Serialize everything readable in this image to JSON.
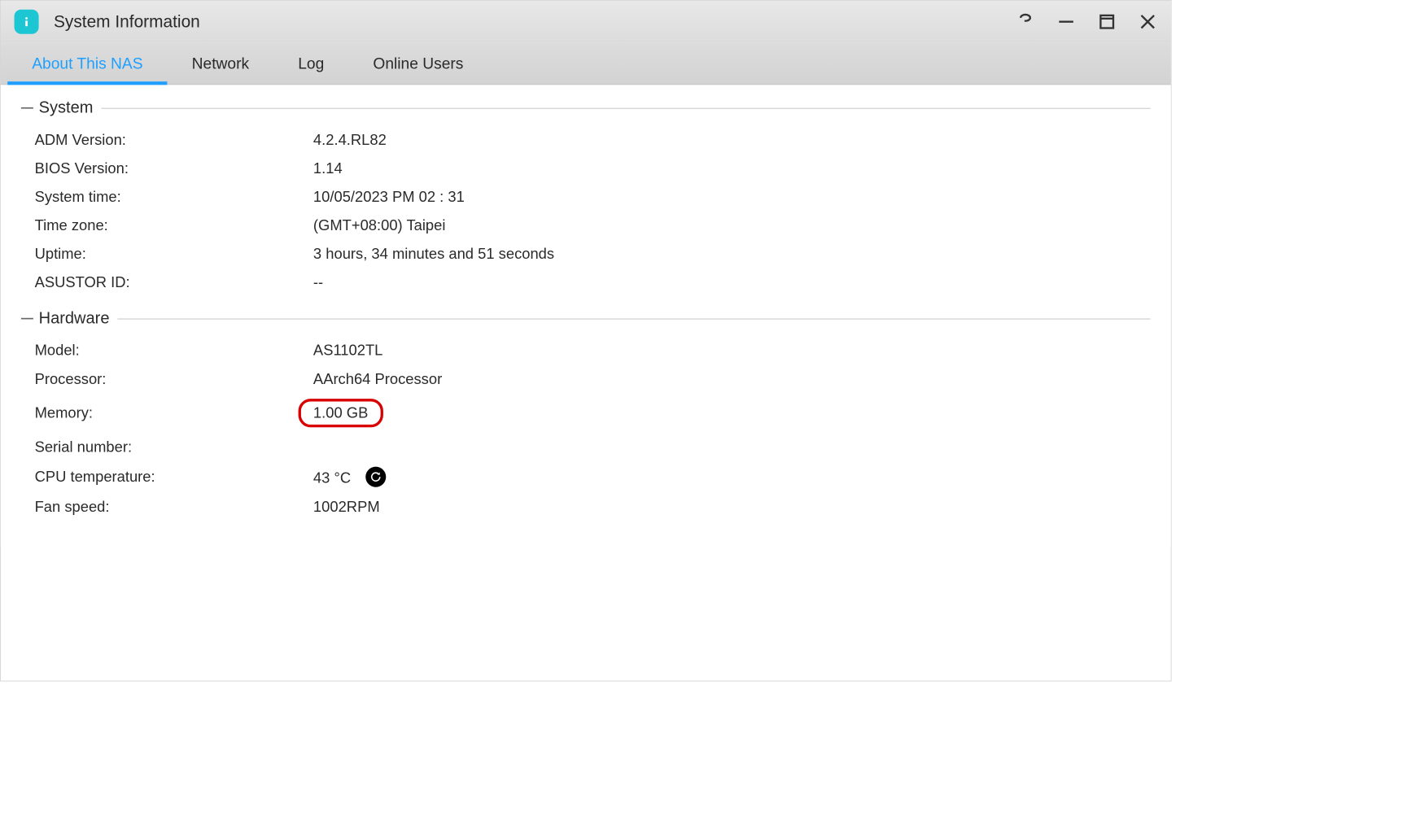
{
  "window": {
    "title": "System Information"
  },
  "tabs": [
    {
      "label": "About This NAS",
      "active": true
    },
    {
      "label": "Network",
      "active": false
    },
    {
      "label": "Log",
      "active": false
    },
    {
      "label": "Online Users",
      "active": false
    }
  ],
  "sections": {
    "system": {
      "title": "System",
      "rows": [
        {
          "label": "ADM Version:",
          "value": "4.2.4.RL82"
        },
        {
          "label": "BIOS Version:",
          "value": "1.14"
        },
        {
          "label": "System time:",
          "value": "10/05/2023  PM 02 : 31"
        },
        {
          "label": "Time zone:",
          "value": "(GMT+08:00) Taipei"
        },
        {
          "label": "Uptime:",
          "value": "3 hours, 34 minutes and 51 seconds"
        },
        {
          "label": "ASUSTOR ID:",
          "value": "--"
        }
      ]
    },
    "hardware": {
      "title": "Hardware",
      "rows": [
        {
          "label": "Model:",
          "value": "AS1102TL"
        },
        {
          "label": "Processor:",
          "value": "AArch64 Processor"
        },
        {
          "label": "Memory:",
          "value": "1.00 GB",
          "highlight": true
        },
        {
          "label": "Serial number:",
          "value": ""
        },
        {
          "label": "CPU temperature:",
          "value": "43 °C",
          "refresh": true
        },
        {
          "label": "Fan speed:",
          "value": "1002RPM"
        }
      ]
    }
  }
}
